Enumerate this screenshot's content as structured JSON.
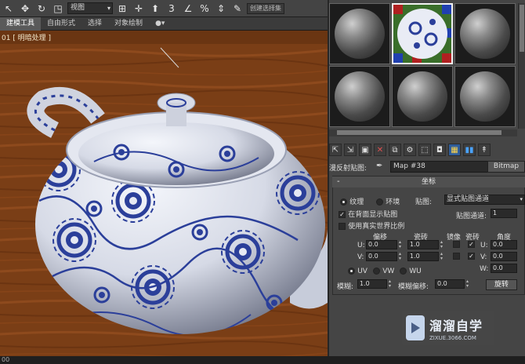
{
  "toolbar": {
    "viewport_select": "视图",
    "selection_set_label": "创建选择集"
  },
  "ribbon": {
    "tabs": [
      {
        "label": "建模工具",
        "active": true
      },
      {
        "label": "自由形式",
        "active": false
      },
      {
        "label": "选择",
        "active": false
      },
      {
        "label": "对象绘制",
        "active": false
      },
      {
        "label": "●▾",
        "active": false
      }
    ]
  },
  "viewport": {
    "label": "01 [ 明暗处理 ]"
  },
  "material_editor": {
    "slots": [
      {
        "type": "standard",
        "active": false
      },
      {
        "type": "porcelain",
        "active": true
      },
      {
        "type": "standard",
        "active": false
      },
      {
        "type": "standard",
        "active": false
      },
      {
        "type": "standard",
        "active": false
      },
      {
        "type": "standard",
        "active": false
      }
    ],
    "map_label": "漫反射贴图:",
    "map_value": "Map #38",
    "map_type_button": "Bitmap",
    "coordinates": {
      "title": "坐标",
      "collapse": "-",
      "texture_label": "纹理",
      "environ_label": "环境",
      "mapping_label": "贴图:",
      "mapping_value": "显式贴图通道",
      "show_map_on_back_label": "在背面显示贴图",
      "show_map_on_back": true,
      "real_world_label": "使用真实世界比例",
      "real_world": false,
      "map_channel_label": "贴图通道:",
      "map_channel_value": "1",
      "offset_label": "偏移",
      "tiling_label": "瓷砖",
      "mirror_label": "镜像",
      "tile_label": "瓷砖",
      "angle_label": "角度",
      "u_label": "U:",
      "v_label": "V:",
      "w_label": "W:",
      "u_offset": "0.0",
      "v_offset": "0.0",
      "u_tiling": "1.0",
      "v_tiling": "1.0",
      "u_mirror": false,
      "v_mirror": false,
      "u_tile": true,
      "v_tile": true,
      "u_angle": "0.0",
      "v_angle": "0.0",
      "w_angle": "0.0",
      "uv_label": "UV",
      "vw_label": "VW",
      "wu_label": "WU",
      "blur_label": "模糊:",
      "blur_value": "1.0",
      "blur_offset_label": "模糊偏移:",
      "blur_offset_value": "0.0",
      "rotate_button": "旋转"
    }
  },
  "status": {
    "left_text": "00"
  },
  "watermark": {
    "title": "溜溜自学",
    "url": "ZIXUE.3066.COM"
  },
  "colors": {
    "wood": "#7a3e16",
    "porcelain_blue": "#2b3f9a",
    "panel": "#454545",
    "highlight": "#2f5d9a"
  }
}
